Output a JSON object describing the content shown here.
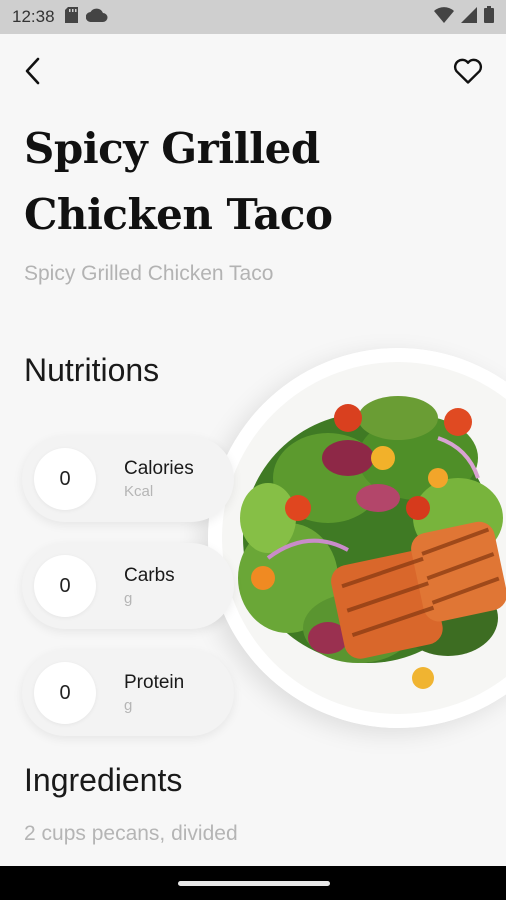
{
  "status_bar": {
    "time": "12:38",
    "left_icons": [
      "sd-card-icon",
      "cloud-icon"
    ],
    "right_icons": [
      "wifi-icon",
      "signal-icon",
      "battery-icon"
    ]
  },
  "header": {
    "back_icon": "chevron-left-icon",
    "favorite_icon": "heart-outline-icon"
  },
  "recipe": {
    "title": "Spicy Grilled Chicken Taco",
    "subtitle": "Spicy Grilled Chicken Taco",
    "image": "salmon-salad-plate"
  },
  "nutrition": {
    "heading": "Nutritions",
    "items": [
      {
        "value": "0",
        "label": "Calories",
        "unit": "Kcal"
      },
      {
        "value": "0",
        "label": "Carbs",
        "unit": "g"
      },
      {
        "value": "0",
        "label": "Protein",
        "unit": "g"
      }
    ]
  },
  "ingredients": {
    "heading": "Ingredients",
    "items": [
      "2 cups pecans, divided"
    ]
  },
  "colors": {
    "background": "#f7f7f7",
    "status_bar": "#cfcfcf",
    "muted_text": "#b3b3b3",
    "card": "#f3f3f3",
    "nav_bar": "#000000"
  }
}
